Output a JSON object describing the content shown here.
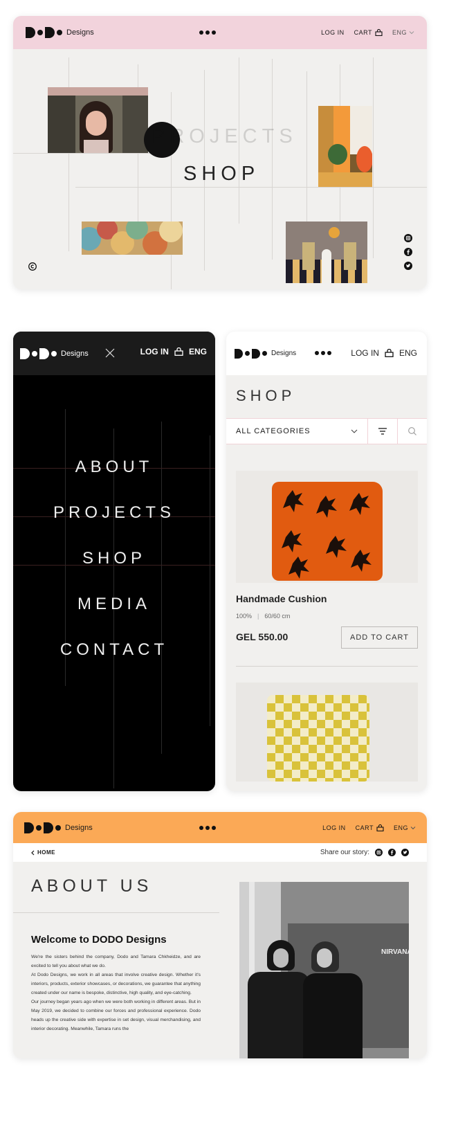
{
  "brand": {
    "logo_text": "Designs"
  },
  "colors": {
    "pink": "#f2d3dc",
    "light_bg": "#f1f0ee",
    "black": "#000000",
    "orange": "#fba956",
    "white": "#ffffff"
  },
  "home": {
    "nav": {
      "login": "LOG IN",
      "cart": "CART",
      "lang": "ENG"
    },
    "menu_items": [
      "PROJECTS",
      "SHOP"
    ]
  },
  "mobile_menu": {
    "nav": {
      "login": "LOG IN",
      "lang": "ENG"
    },
    "items": [
      "ABOUT",
      "PROJECTS",
      "SHOP",
      "MEDIA",
      "CONTACT"
    ]
  },
  "shop": {
    "nav": {
      "login": "LOG IN",
      "lang": "ENG"
    },
    "title": "SHOP",
    "category_select": "ALL CATEGORIES",
    "product": {
      "name": "Handmade Cushion",
      "material": "100%",
      "size": "60/60 cm",
      "price": "GEL 550.00",
      "add_to_cart": "ADD TO CART"
    }
  },
  "about": {
    "nav": {
      "login": "LOG IN",
      "cart": "CART",
      "lang": "ENG"
    },
    "back": "HOME",
    "share_label": "Share our story:",
    "title": "ABOUT US",
    "heading": "Welcome to DODO Designs",
    "paragraphs": [
      "We're the sisters behind the company, Dodo and Tamara Chkheidze, and are excited to tell you about what we do.",
      "At Dodo Designs, we work in all areas that involve creative design. Whether it's interiors, products, exterior showcases, or decorations, we guarantee that anything created under our name is bespoke, distinctive, high quality, and eye-catching.",
      "Our journey began years ago when we were both working in different areas. But in May 2019, we decided to combine our forces and professional experience. Dodo heads up the creative side with expertise in set design, visual merchandising, and interior decorating. Meanwhile, Tamara runs the"
    ],
    "poster_text": "NIRVANA"
  },
  "icons": [
    "instagram-icon",
    "facebook-icon",
    "twitter-icon",
    "cart-icon",
    "chevron-down-icon",
    "close-icon",
    "filter-icon",
    "search-icon",
    "copyright-icon",
    "chevron-left-icon"
  ]
}
